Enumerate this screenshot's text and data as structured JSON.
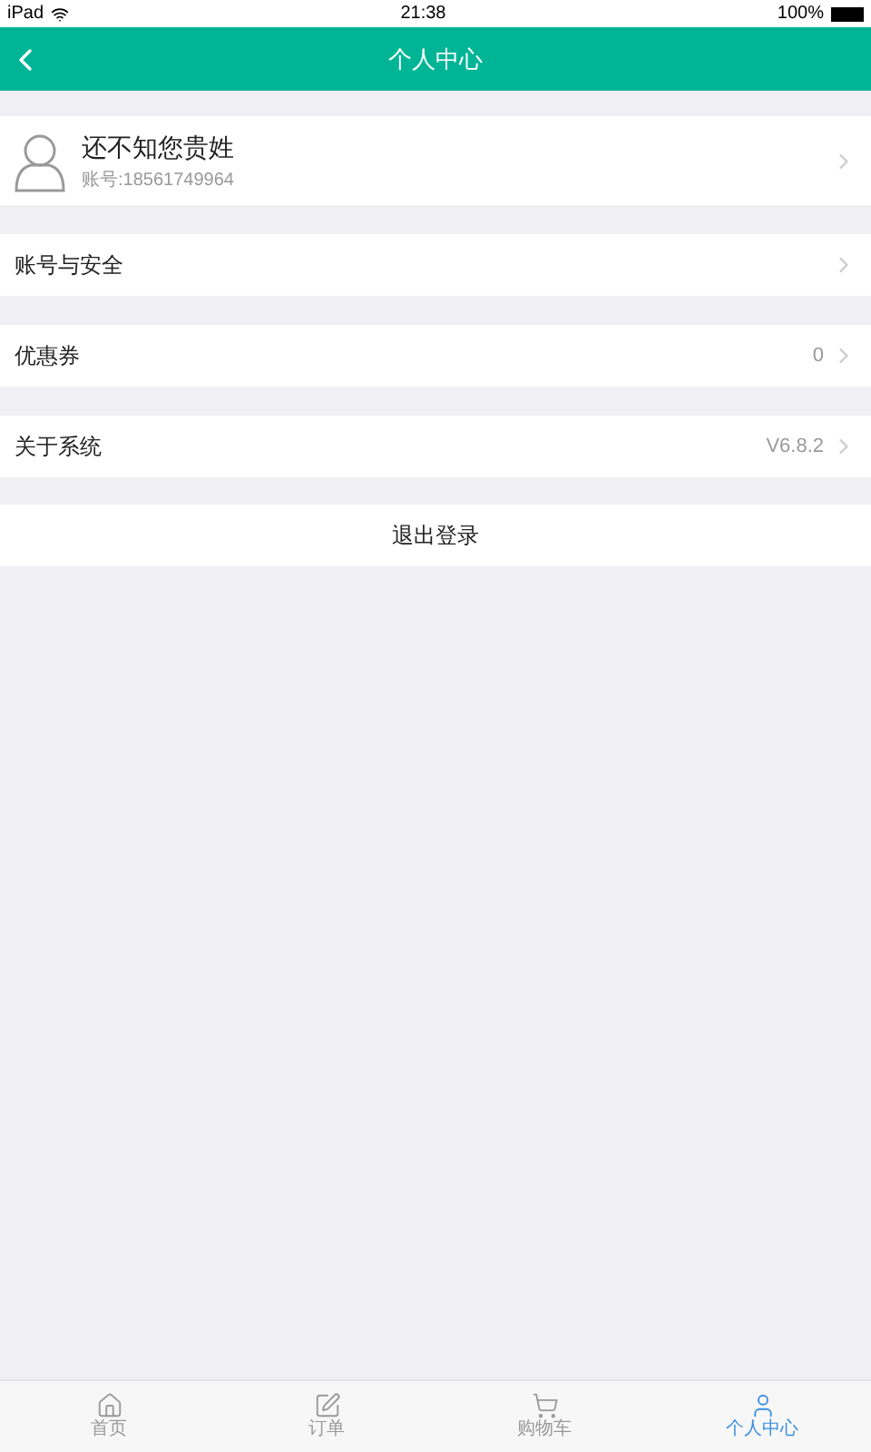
{
  "status_bar": {
    "device": "iPad",
    "time": "21:38",
    "battery": "100%"
  },
  "header": {
    "title": "个人中心"
  },
  "profile": {
    "name": "还不知您贵姓",
    "account": "账号:18561749964"
  },
  "menu": [
    {
      "label": "账号与安全"
    },
    {
      "label": "优惠券",
      "value": "0"
    },
    {
      "label": "关于系统",
      "value": "V6.8.2"
    }
  ],
  "logout": "退出登录",
  "tabs": [
    {
      "label": "首页",
      "selected": false
    },
    {
      "label": "订单",
      "selected": false
    },
    {
      "label": "购物车",
      "selected": false
    },
    {
      "label": "个人中心",
      "selected": true
    }
  ]
}
